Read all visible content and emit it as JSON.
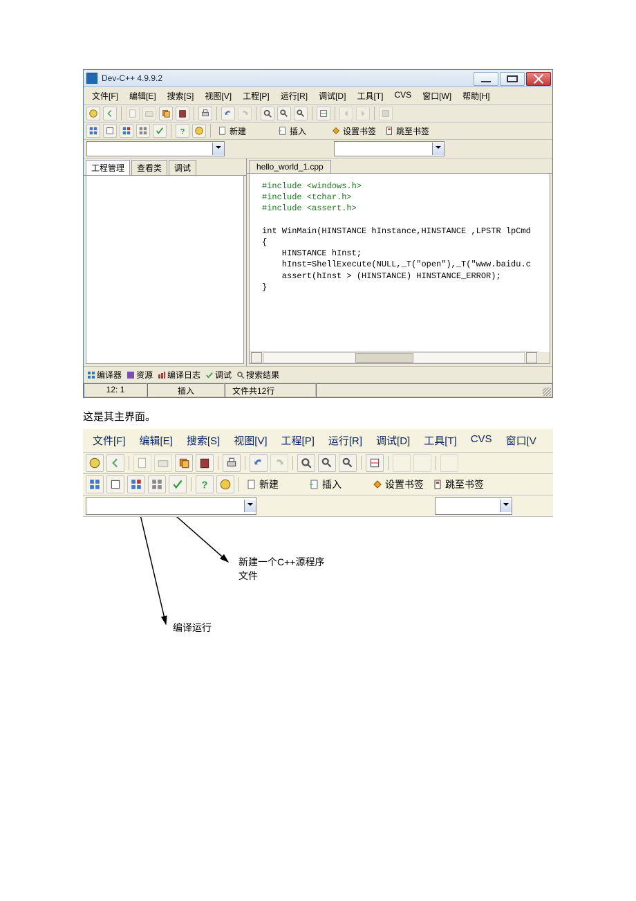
{
  "window": {
    "title": "Dev-C++ 4.9.9.2"
  },
  "menu": [
    "文件[F]",
    "编辑[E]",
    "搜索[S]",
    "视图[V]",
    "工程[P]",
    "运行[R]",
    "调试[D]",
    "工具[T]",
    "CVS",
    "窗口[W]",
    "帮助[H]"
  ],
  "toolbar_text": {
    "new": "新建",
    "insert": "插入",
    "setbm": "设置书签",
    "gotobm": "跳至书签"
  },
  "side_tabs": [
    "工程管理",
    "查看类",
    "调试"
  ],
  "editor_tab": "hello_world_1.cpp",
  "code": {
    "l1": "#include <windows.h>",
    "l2": "#include <tchar.h>",
    "l3": "#include <assert.h>",
    "l4": "int WinMain(HINSTANCE hInstance,HINSTANCE ,LPSTR lpCmd",
    "l5": "{",
    "l6": "    HINSTANCE hInst;",
    "l7": "    hInst=ShellExecute(NULL,_T(\"open\"),_T(\"www.baidu.c",
    "l8": "    assert(hInst > (HINSTANCE) HINSTANCE_ERROR);",
    "l9": "}"
  },
  "bottom_tabs": [
    "编译器",
    "资源",
    "编译日志",
    "调试",
    "搜索结果"
  ],
  "status": {
    "pos": "12: 1",
    "mode": "插入",
    "lines": "文件共12行"
  },
  "caption": "这是其主界面。",
  "menu2": [
    "文件[F]",
    "编辑[E]",
    "搜索[S]",
    "视图[V]",
    "工程[P]",
    "运行[R]",
    "调试[D]",
    "工具[T]",
    "CVS",
    "窗口[V"
  ],
  "annot": {
    "new_src": "新建一个C++源程序\n文件",
    "compile_run": "编译运行"
  }
}
